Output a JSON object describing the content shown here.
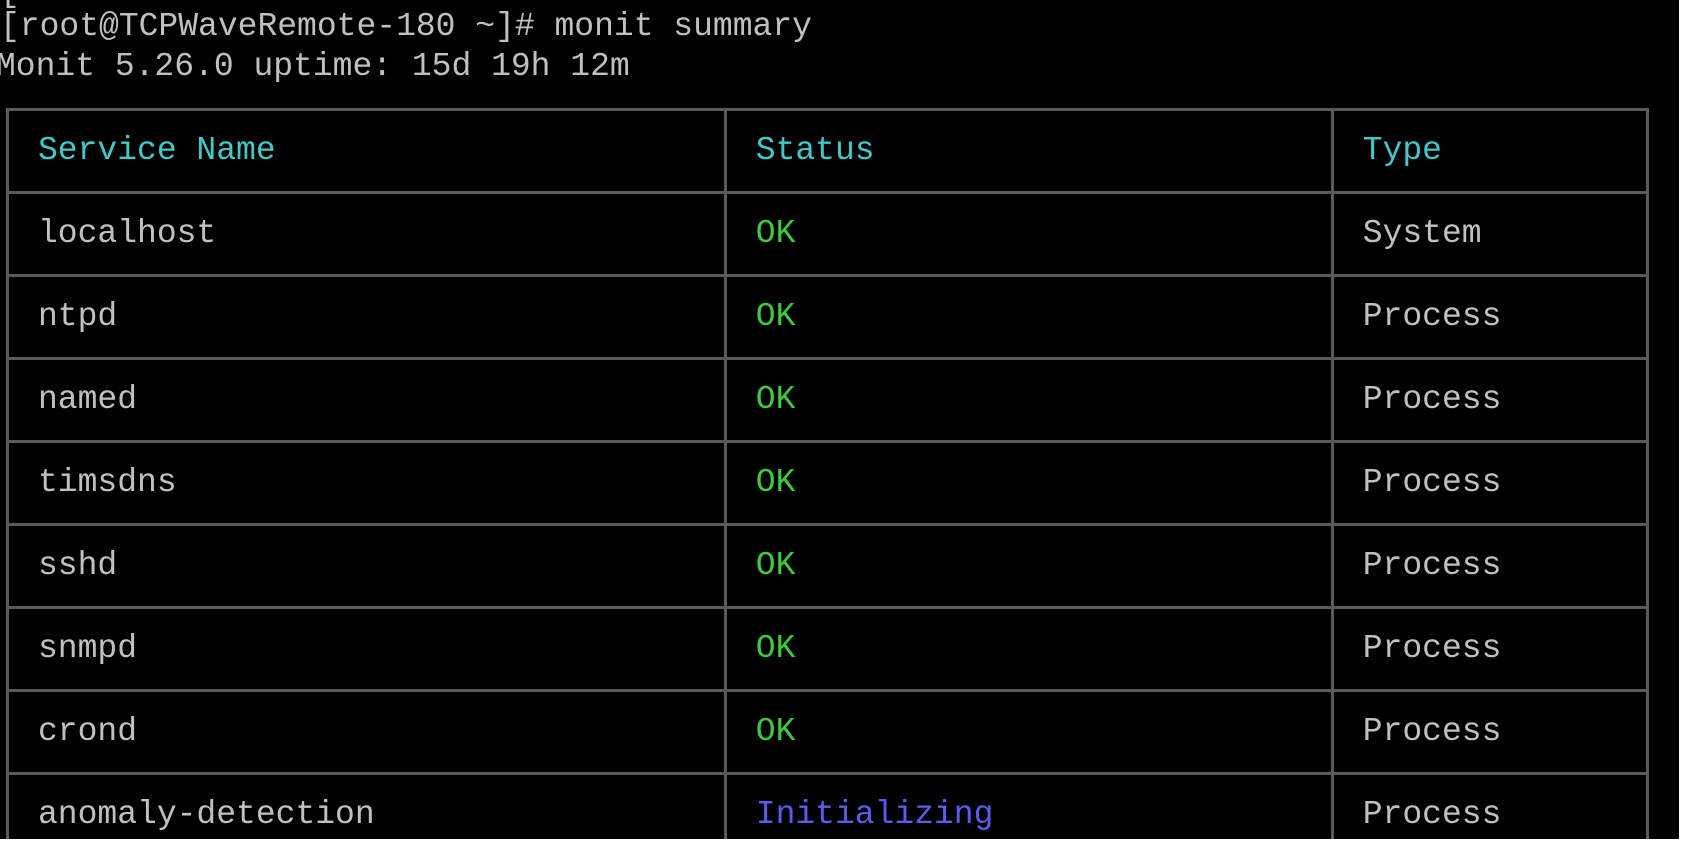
{
  "terminal": {
    "clipped_line": "[",
    "prompt": "[root@TCPWaveRemote-180 ~]# monit summary",
    "info": "Monit 5.26.0 uptime: 15d 19h 12m"
  },
  "table": {
    "headers": [
      "Service Name",
      "Status",
      "Type"
    ],
    "rows": [
      {
        "name": "localhost",
        "status": "OK",
        "type": "System"
      },
      {
        "name": "ntpd",
        "status": "OK",
        "type": "Process"
      },
      {
        "name": "named",
        "status": "OK",
        "type": "Process"
      },
      {
        "name": "timsdns",
        "status": "OK",
        "type": "Process"
      },
      {
        "name": "sshd",
        "status": "OK",
        "type": "Process"
      },
      {
        "name": "snmpd",
        "status": "OK",
        "type": "Process"
      },
      {
        "name": "crond",
        "status": "OK",
        "type": "Process"
      },
      {
        "name": "anomaly-detection",
        "status": "Initializing",
        "type": "Process"
      }
    ]
  },
  "colors": {
    "background": "#000000",
    "text": "#c0c0c0",
    "header": "#3fc9c9",
    "status_ok": "#3ec93e",
    "status_initializing": "#5a5cf0",
    "border": "#5a5a5a"
  }
}
